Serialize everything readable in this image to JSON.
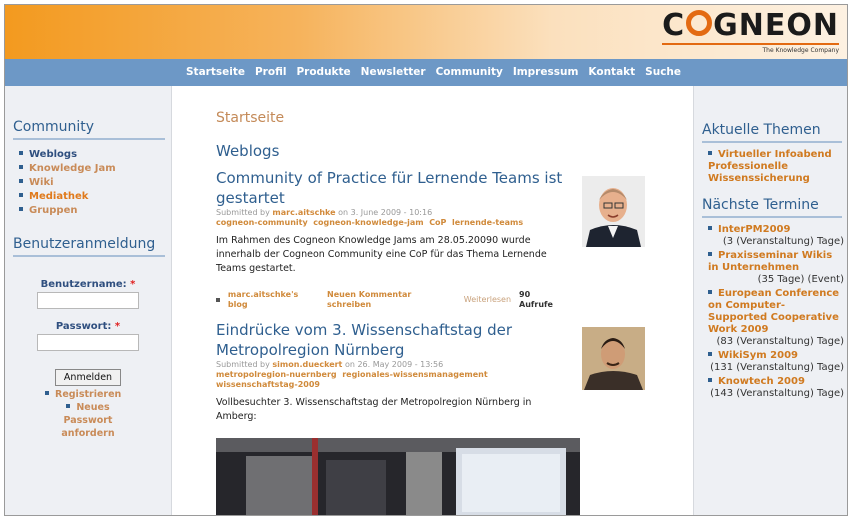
{
  "logo": {
    "text_c": "C",
    "text_gneon": "GNEON",
    "tagline": "The Knowledge Company"
  },
  "nav": [
    "Startseite",
    "Profil",
    "Produkte",
    "Newsletter",
    "Community",
    "Impressum",
    "Kontakt",
    "Suche"
  ],
  "left": {
    "community_title": "Community",
    "community_items": [
      {
        "label": "Weblogs"
      },
      {
        "label": "Knowledge Jam"
      },
      {
        "label": "Wiki"
      },
      {
        "label": "Mediathek"
      },
      {
        "label": "Gruppen"
      }
    ],
    "login_title": "Benutzeranmeldung",
    "username_label": "Benutzername:",
    "password_label": "Passwort:",
    "required_mark": "*",
    "login_button": "Anmelden",
    "register_link": "Registrieren",
    "password_link": "Neues Passwort anfordern"
  },
  "main": {
    "breadcrumb": "Startseite",
    "section": "Weblogs",
    "post1": {
      "title": "Community of Practice für Lernende Teams ist gestartet",
      "submitted": "Submitted by",
      "author": "marc.aitschke",
      "date": "on 3. June 2009 - 10:16",
      "tags": [
        "cogneon-community",
        "cogneon-knowledge-jam",
        "CoP",
        "lernende-teams"
      ],
      "body": "Im Rahmen des Cogneon Knowledge Jams am 28.05.20090 wurde innerhalb der Cogneon Community eine CoP für das Thema Lernende Teams gestartet.",
      "link_blog": "marc.aitschke's blog",
      "link_comment": "Neuen Kommentar schreiben",
      "link_more": "Weiterlesen",
      "count": "90 Aufrufe"
    },
    "post2": {
      "title": "Eindrücke vom 3. Wissenschaftstag der Metropolregion Nürnberg",
      "submitted": "Submitted by",
      "author": "simon.dueckert",
      "date": "on 26. May 2009 - 13:56",
      "tags": [
        "metropolregion-nuernberg",
        "regionales-wissensmanagement",
        "wissenschaftstag-2009"
      ],
      "body": "Vollbesuchter 3. Wissenschaftstag der Metropolregion Nürnberg in Amberg:"
    }
  },
  "right": {
    "topics_title": "Aktuelle Themen",
    "topics": [
      "Virtueller Infoabend Professionelle Wissenssicherung"
    ],
    "events_title": "Nächste Termine",
    "events": [
      {
        "title": "InterPM2009",
        "info": "(3 (Veranstaltung) Tage)"
      },
      {
        "title": "Praxisseminar Wikis in Unternehmen",
        "info": "(35 Tage) (Event)"
      },
      {
        "title": "European Conference on Computer-Supported Cooperative Work 2009",
        "info": "(83 (Veranstaltung) Tage)"
      },
      {
        "title": "WikiSym 2009",
        "info": "(131 (Veranstaltung) Tage)"
      },
      {
        "title": "Knowtech 2009",
        "info": "(143 (Veranstaltung) Tage)"
      }
    ]
  },
  "colors": {
    "orange": "#f39a1f",
    "nav_blue": "#6d98c6",
    "title_blue": "#2f5f8f",
    "link_orange": "#d08a3b"
  }
}
